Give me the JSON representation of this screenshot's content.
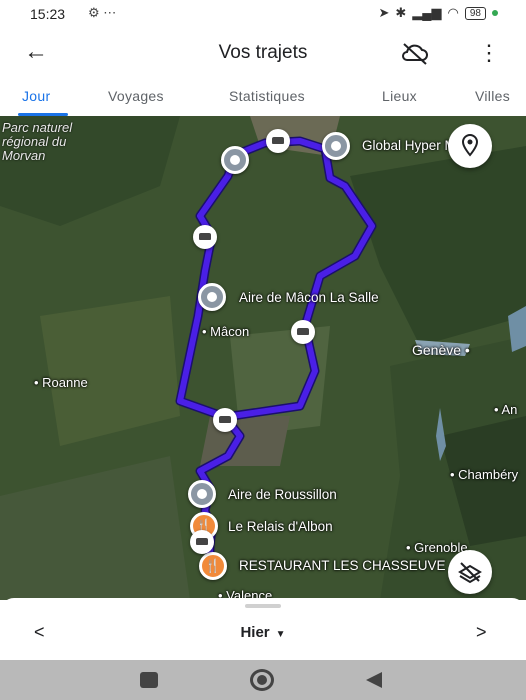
{
  "status_bar": {
    "time": "15:23",
    "left_icons": "⚙ ⋯",
    "battery": "98"
  },
  "app_bar": {
    "title": "Vos trajets"
  },
  "tabs": [
    {
      "label": "Jour",
      "active": true
    },
    {
      "label": "Voyages",
      "active": false
    },
    {
      "label": "Statistiques",
      "active": false
    },
    {
      "label": "Lieux",
      "active": false
    },
    {
      "label": "Villes",
      "active": false
    }
  ],
  "map": {
    "region_label": "Parc naturel régional du Morvan",
    "places": {
      "macon": "Mâcon",
      "roanne": "Roanne",
      "geneve": "Genève",
      "chambery": "Chambéry",
      "grenoble": "Grenoble",
      "valence": "Valence",
      "anne": "An"
    },
    "stops": {
      "global": "Global Hyper Mon",
      "aire_macon": "Aire de Mâcon La Salle",
      "aire_roussillon": "Aire de Roussillon",
      "relais_albon": "Le Relais d'Albon",
      "restaurant": "RESTAURANT LES CHASSEUVE"
    },
    "route_color": "#4a1fe6"
  },
  "bottom_bar": {
    "date": "Hier"
  }
}
